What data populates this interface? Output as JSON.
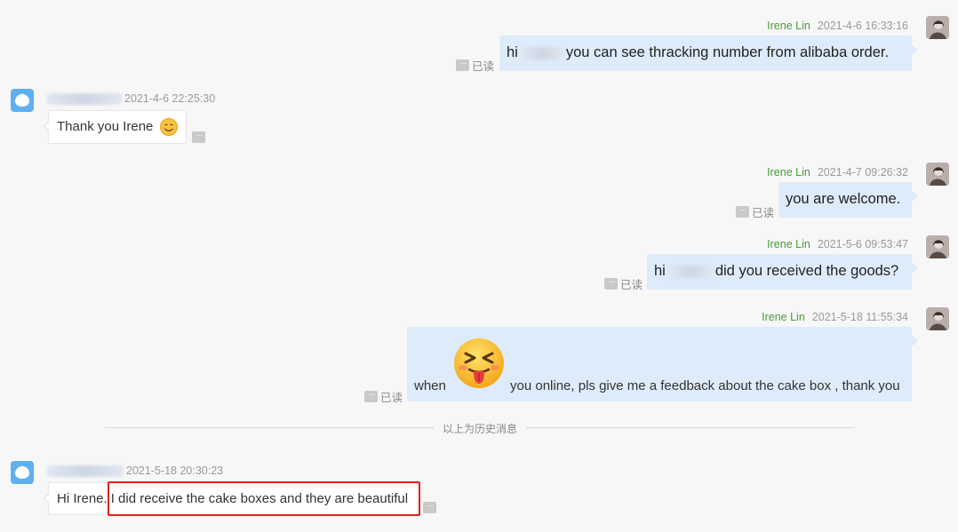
{
  "messages": [
    {
      "sender": "Irene Lin",
      "time": "2021-4-6 16:33:16",
      "prefix": "hi",
      "text": "you can see thracking number from alibaba order.",
      "status": "已读"
    },
    {
      "time": "2021-4-6 22:25:30",
      "text": "Thank you Irene",
      "emoji": "smile-emoji"
    },
    {
      "sender": "Irene Lin",
      "time": "2021-4-7 09:26:32",
      "text": "you are welcome.",
      "status": "已读"
    },
    {
      "sender": "Irene Lin",
      "time": "2021-5-6 09:53:47",
      "prefix": "hi",
      "text": "did you received the goods?",
      "status": "已读"
    },
    {
      "sender": "Irene Lin",
      "time": "2021-5-18 11:55:34",
      "prefix": "when",
      "emoji": "tongue-out-emoji",
      "text": "you online, pls give me a feedback about the cake box , thank you",
      "status": "已读"
    },
    {
      "time": "2021-5-18 20:30:23",
      "prefix": "Hi Irene.",
      "text": "I did receive the cake boxes and they are beautiful"
    }
  ],
  "divider": "以上为历史消息",
  "more_label": "···",
  "colors": {
    "sender_name": "#4a9a3a",
    "outgoing_bubble": "#deebfb",
    "highlight": "#e0231c",
    "customer_avatar": "#5eb0f0"
  }
}
